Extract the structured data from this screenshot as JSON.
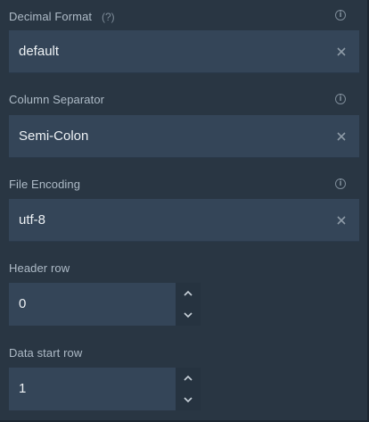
{
  "fields": {
    "decimal_format": {
      "label": "Decimal Format",
      "help": "(?)",
      "value": "default",
      "info_glyph": "i"
    },
    "column_separator": {
      "label": "Column Separator",
      "value": "Semi-Colon",
      "info_glyph": "i"
    },
    "file_encoding": {
      "label": "File Encoding",
      "value": "utf-8",
      "info_glyph": "i"
    },
    "header_row": {
      "label": "Header row",
      "value": "0"
    },
    "data_start_row": {
      "label": "Data start row",
      "value": "1"
    }
  },
  "icons": {
    "clear": "close-icon",
    "info": "info-icon",
    "increment": "chevron-up-icon",
    "decrement": "chevron-down-icon"
  },
  "colors": {
    "background": "#293643",
    "input_background": "#344558",
    "label_text": "#aebbc7",
    "value_text": "#eef2f5",
    "icon_muted": "#7d8b98"
  }
}
